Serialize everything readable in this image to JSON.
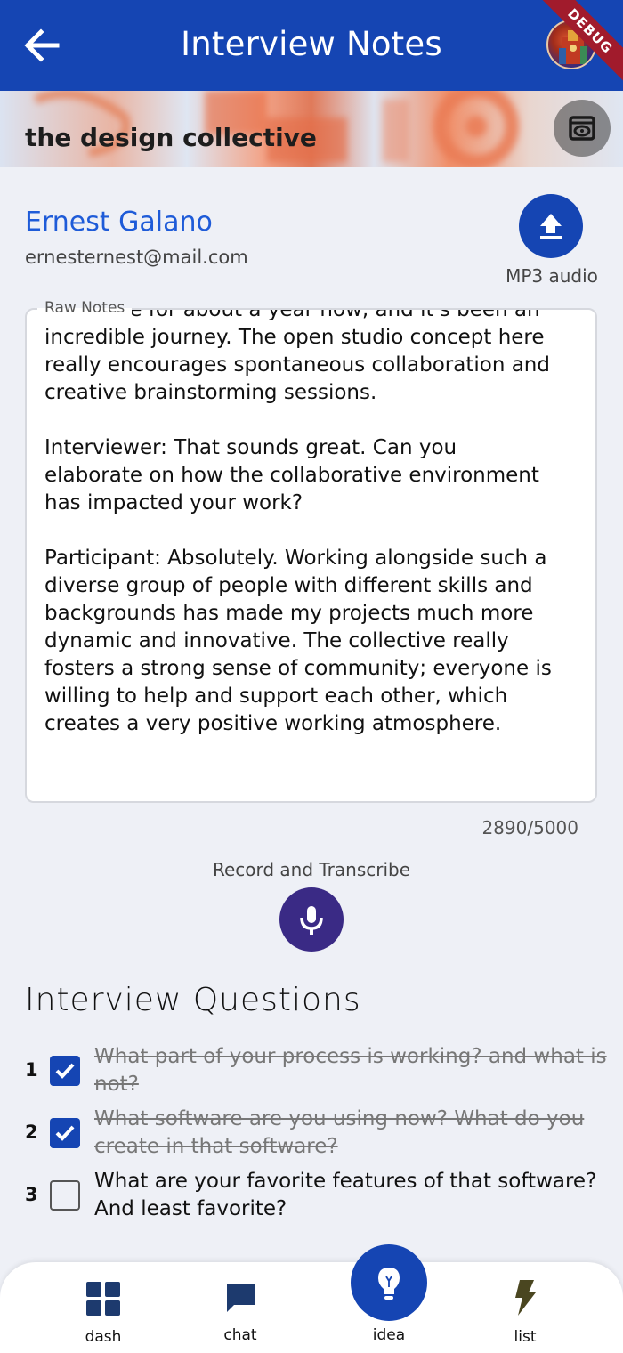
{
  "appbar": {
    "title": "Interview Notes",
    "debug_label": "DEBUG"
  },
  "banner": {
    "title": "the design collective"
  },
  "profile": {
    "name": "Ernest Galano",
    "email": "ernesternest@mail.com",
    "upload_label": "MP3 audio"
  },
  "notes": {
    "label": "Raw Notes",
    "text": "collective for about a year now, and it's been an\nincredible journey. The open studio concept here\nreally encourages spontaneous collaboration and\ncreative brainstorming sessions.\n\nInterviewer: That sounds great. Can you\nelaborate on how the collaborative environment\nhas impacted your work?\n\nParticipant: Absolutely. Working alongside such a\ndiverse group of people with different skills and\nbackgrounds has made my projects much more\ndynamic and innovative. The collective really\nfosters a strong sense of community; everyone is\nwilling to help and support each other, which\ncreates a very positive working atmosphere.",
    "counter": "2890/5000"
  },
  "record": {
    "label": "Record and Transcribe"
  },
  "questions": {
    "title": "Interview Questions",
    "items": [
      {
        "number": "1",
        "checked": true,
        "text": "What part of your process is working? and what is not?"
      },
      {
        "number": "2",
        "checked": true,
        "text": "What software are you using now? What do you create in that software?"
      },
      {
        "number": "3",
        "checked": false,
        "text": "What are your favorite features of that software? And least favorite?"
      }
    ]
  },
  "nav": {
    "items": [
      {
        "label": "dash",
        "icon": "dashboard-icon"
      },
      {
        "label": "chat",
        "icon": "chat-icon"
      },
      {
        "label": "idea",
        "icon": "lightbulb-icon",
        "active": true
      },
      {
        "label": "list",
        "icon": "lightning-icon"
      }
    ]
  },
  "colors": {
    "primary": "#1545b3",
    "mic": "#3a2a85",
    "name": "#1e5bd8",
    "background": "#eef0f6"
  }
}
